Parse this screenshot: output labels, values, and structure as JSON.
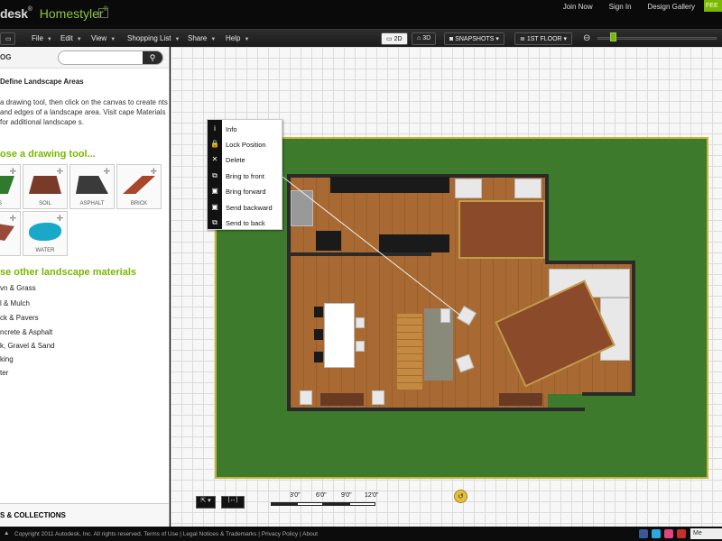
{
  "header": {
    "brand": "desk",
    "brand_mark": "®",
    "product": "Homestyler",
    "product_mark": "®",
    "links": [
      "Join Now",
      "Sign In",
      "Design Gallery"
    ],
    "feed_label": "FEE"
  },
  "menu": {
    "items": [
      "File",
      "Edit",
      "View",
      "Shopping List",
      "Share",
      "Help"
    ],
    "view2d": "2D",
    "view3d": "3D",
    "snapshots": "SNAPSHOTS",
    "floor": "1ST FLOOR"
  },
  "left_panel": {
    "tag": "OG",
    "search_placeholder": "",
    "title": "Define Landscape Areas",
    "description": "a drawing tool, then click on the canvas to create nts and edges of a landscape area. Visit cape Materials for additional landscape s.",
    "tool_heading": "ose a drawing tool...",
    "tools": [
      {
        "label": "SS",
        "color": "#2f7a2c"
      },
      {
        "label": "SOIL",
        "color": "#7a3a2a"
      },
      {
        "label": "ASPHALT",
        "color": "#3a3a3a"
      },
      {
        "label": "BRICK",
        "color": "#a8452a"
      },
      {
        "label": "K",
        "color": "#9a4a3a"
      },
      {
        "label": "WATER",
        "color": "#1aa8c8"
      }
    ],
    "materials_heading": "se other landscape materials",
    "materials": [
      "vn & Grass",
      "l & Mulch",
      "ck & Pavers",
      "ncrete & Asphalt",
      "k, Gravel & Sand",
      "king",
      "ter"
    ],
    "footer": "S & COLLECTIONS"
  },
  "context_menu": [
    {
      "label": "Info",
      "icon": "i"
    },
    {
      "label": "Lock Position",
      "icon": "🔒"
    },
    {
      "label": "Delete",
      "icon": "✕"
    },
    {
      "label": "Bring to front",
      "icon": "⧉"
    },
    {
      "label": "Bring forward",
      "icon": "▣"
    },
    {
      "label": "Send backward",
      "icon": "▣"
    },
    {
      "label": "Send to back",
      "icon": "⧉"
    }
  ],
  "scale": {
    "labels": [
      "3'0\"",
      "6'0\"",
      "9'0\"",
      "12'0\""
    ]
  },
  "canvas_controls": {
    "pan_label": "⇱ ▾",
    "measure_label": "|↔|"
  },
  "footer": {
    "text": "Copyright 2011 Autodesk, Inc. All rights reserved. Terms of Use | Legal Notices & Trademarks | Privacy Policy | About",
    "mini_label": "Me"
  },
  "colors": {
    "accent": "#7ab800",
    "lawn": "#3e7a2c",
    "floor": "#a86a32"
  }
}
